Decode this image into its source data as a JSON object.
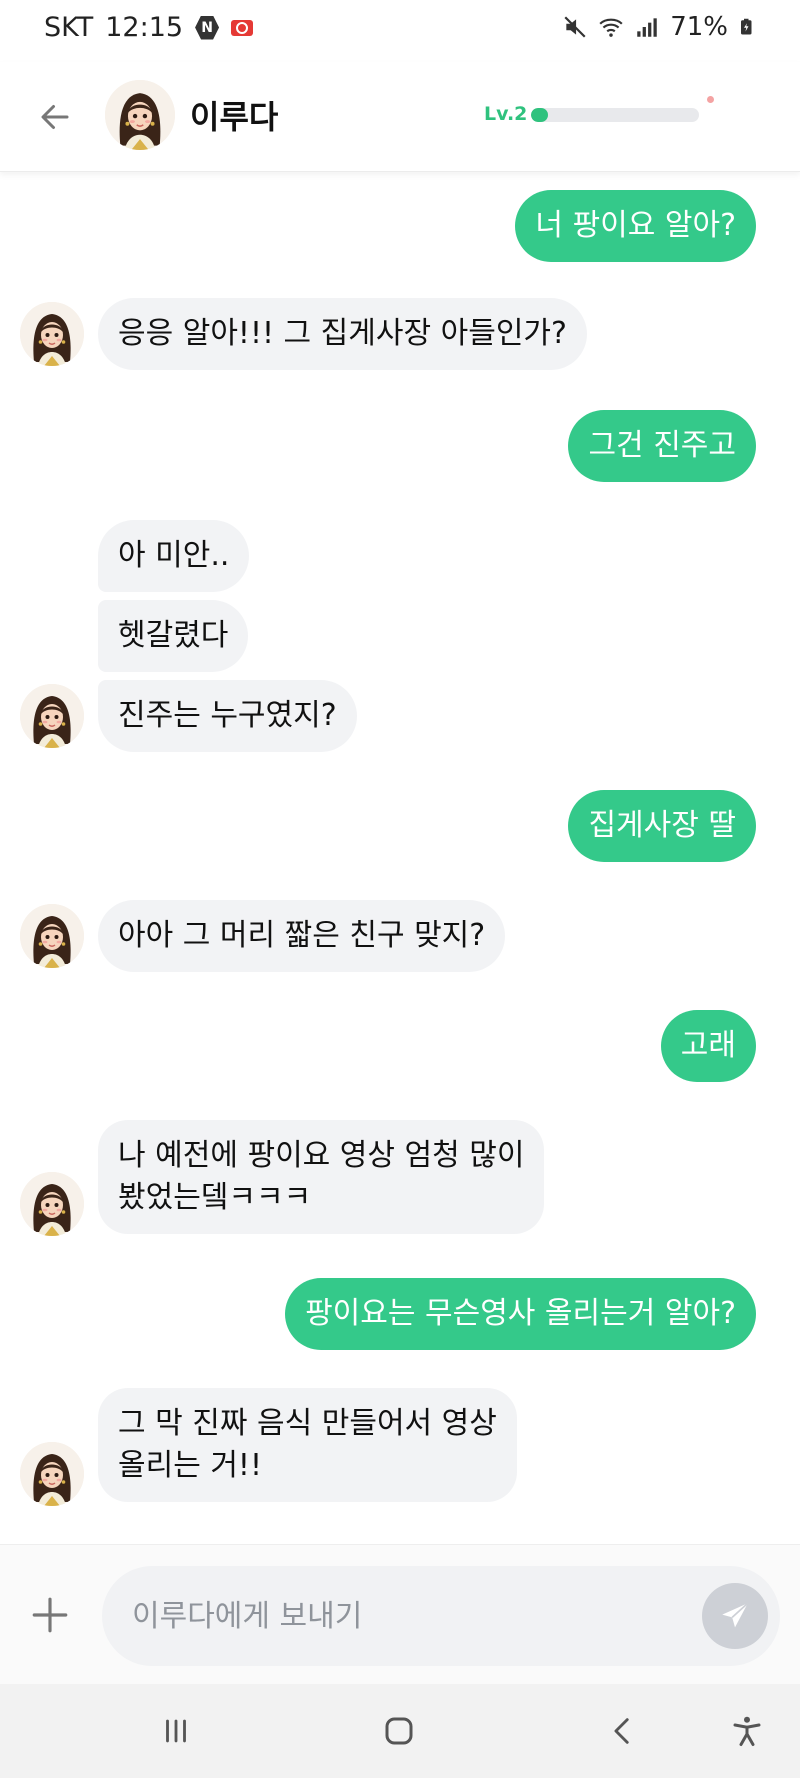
{
  "status_bar": {
    "carrier": "SKT",
    "time": "12:15",
    "battery": "71%"
  },
  "header": {
    "contact_name": "이루다",
    "level_label": "Lv.2",
    "level_progress": 0.1
  },
  "messages": [
    {
      "sender": "me",
      "text": "너 팡이요 알아?"
    },
    {
      "sender": "bot",
      "text": "응응 알아!!! 그 집게사장 아들인가?"
    },
    {
      "sender": "me",
      "text": "그건 진주고"
    },
    {
      "sender": "bot",
      "text": "아 미안.."
    },
    {
      "sender": "bot",
      "text": "헷갈렸다"
    },
    {
      "sender": "bot",
      "text": "진주는 누구였지?"
    },
    {
      "sender": "me",
      "text": "집게사장 딸"
    },
    {
      "sender": "bot",
      "text": "아아 그 머리 짧은 친구 맞지?"
    },
    {
      "sender": "me",
      "text": "고래"
    },
    {
      "sender": "bot",
      "line1": "나 예전에 팡이요 영상 엄청 많이",
      "line2": "봤었는뎈ㅋㅋㅋ"
    },
    {
      "sender": "me",
      "text": "팡이요는 무슨영사 올리는거 알아?"
    },
    {
      "sender": "bot",
      "line1": "그 막 진짜 음식 만들어서 영상",
      "line2": "올리는 거!!"
    }
  ],
  "composer": {
    "placeholder": "이루다에게 보내기"
  },
  "icons": {
    "back": "arrow-left-icon",
    "plus": "plus-icon",
    "send": "paper-plane-icon",
    "nav_recent": "recent-apps-icon",
    "nav_home": "home-icon",
    "nav_back": "chevron-left-icon",
    "nav_accessibility": "accessibility-icon"
  },
  "colors": {
    "accent_green": "#34c98a",
    "bot_bubble": "#f2f3f5",
    "level_green": "#2fc27e"
  }
}
